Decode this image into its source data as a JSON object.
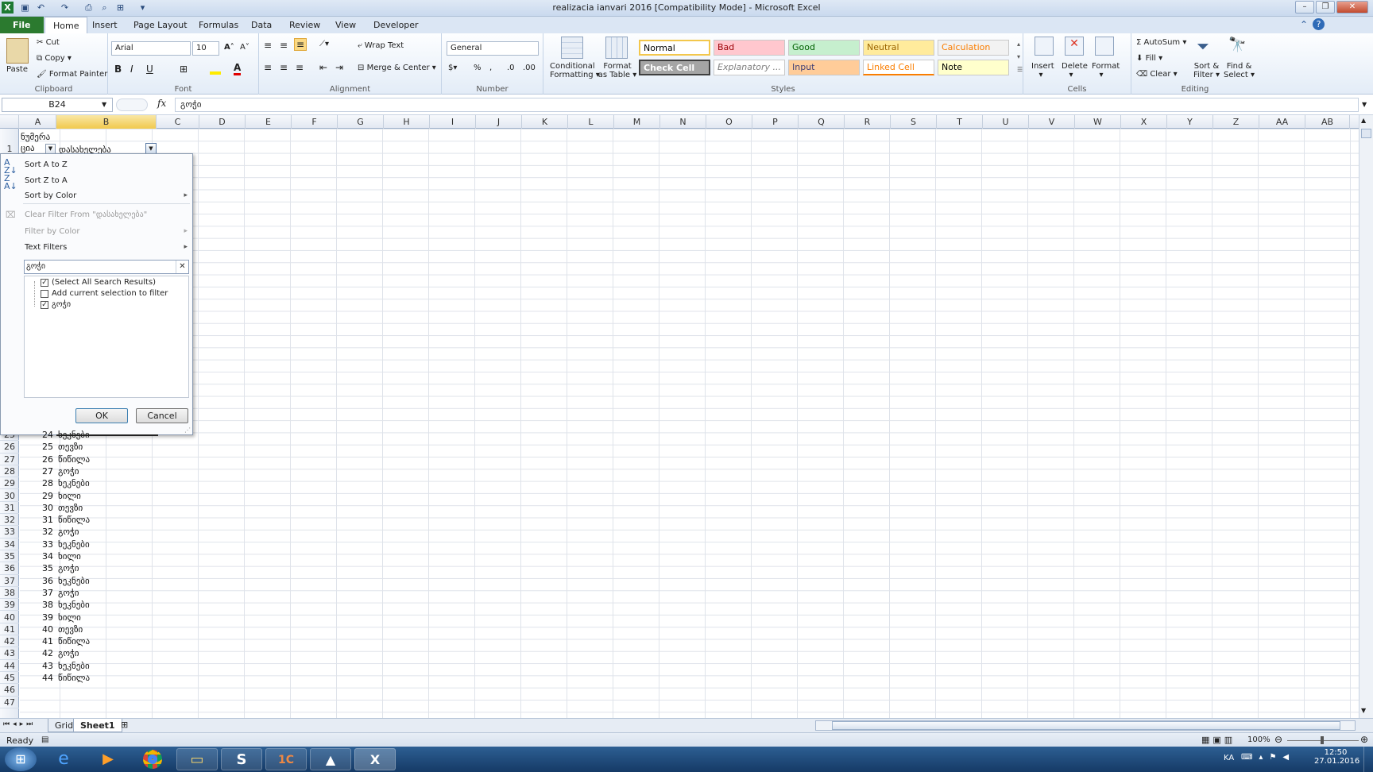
{
  "window": {
    "title": "realizacia ianvari 2016  [Compatibility Mode]  -  Microsoft Excel"
  },
  "tabs": [
    "File",
    "Home",
    "Insert",
    "Page Layout",
    "Formulas",
    "Data",
    "Review",
    "View",
    "Developer"
  ],
  "ribbon": {
    "clipboard": {
      "paste": "Paste",
      "cut": "Cut",
      "copy": "Copy",
      "format_painter": "Format Painter",
      "label": "Clipboard"
    },
    "font": {
      "name": "Arial",
      "size": "10",
      "label": "Font"
    },
    "alignment": {
      "wrap": "Wrap Text",
      "merge": "Merge & Center",
      "label": "Alignment"
    },
    "number": {
      "format": "General",
      "label": "Number"
    },
    "styles": {
      "conditional": "Conditional",
      "conditional2": "Formatting",
      "format_table": "Format",
      "format_table2": "as Table",
      "label": "Styles",
      "items": [
        {
          "name": "Normal",
          "bg": "#ffffff",
          "fg": "#000000"
        },
        {
          "name": "Bad",
          "bg": "#ffc7ce",
          "fg": "#9c0006"
        },
        {
          "name": "Good",
          "bg": "#c6efce",
          "fg": "#006100"
        },
        {
          "name": "Neutral",
          "bg": "#ffeb9c",
          "fg": "#9c6500"
        },
        {
          "name": "Calculation",
          "bg": "#f2f2f2",
          "fg": "#fa7d00"
        },
        {
          "name": "Check Cell",
          "bg": "#a5a5a5",
          "fg": "#ffffff"
        },
        {
          "name": "Explanatory ...",
          "bg": "#ffffff",
          "fg": "#7f7f7f"
        },
        {
          "name": "Input",
          "bg": "#ffcc99",
          "fg": "#3f3f76"
        },
        {
          "name": "Linked Cell",
          "bg": "#ffffff",
          "fg": "#fa7d00"
        },
        {
          "name": "Note",
          "bg": "#ffffcc",
          "fg": "#000000"
        }
      ]
    },
    "cells": {
      "insert": "Insert",
      "delete": "Delete",
      "format": "Format",
      "label": "Cells"
    },
    "editing": {
      "autosum": "AutoSum",
      "fill": "Fill",
      "clear": "Clear",
      "sort": "Sort &",
      "sort2": "Filter",
      "find": "Find &",
      "find2": "Select",
      "label": "Editing"
    }
  },
  "formula_bar": {
    "name_box": "B24",
    "fx": "fx",
    "value": "გოჭი"
  },
  "columns": [
    "A",
    "B",
    "C",
    "D",
    "E",
    "F",
    "G",
    "H",
    "I",
    "J",
    "K",
    "L",
    "M",
    "N",
    "O",
    "P",
    "Q",
    "R",
    "S",
    "T",
    "U",
    "V",
    "W",
    "X",
    "Y",
    "Z",
    "AA",
    "AB"
  ],
  "header_row": {
    "a_line1": "ნუმერა",
    "a_line2": "ცია",
    "b": "დასახელება"
  },
  "rows": [
    {
      "r": "25",
      "a": "24",
      "b": "ხეკნები"
    },
    {
      "r": "26",
      "a": "25",
      "b": "თევზი"
    },
    {
      "r": "27",
      "a": "26",
      "b": "წიწილა"
    },
    {
      "r": "28",
      "a": "27",
      "b": "გოჭი"
    },
    {
      "r": "29",
      "a": "28",
      "b": "ხეკნები"
    },
    {
      "r": "30",
      "a": "29",
      "b": "ხილი"
    },
    {
      "r": "31",
      "a": "30",
      "b": "თევზი"
    },
    {
      "r": "32",
      "a": "31",
      "b": "წიწილა"
    },
    {
      "r": "33",
      "a": "32",
      "b": "გოჭი"
    },
    {
      "r": "34",
      "a": "33",
      "b": "ხეკნები"
    },
    {
      "r": "35",
      "a": "34",
      "b": "ხილი"
    },
    {
      "r": "36",
      "a": "35",
      "b": "გოჭი"
    },
    {
      "r": "37",
      "a": "36",
      "b": "ხეკნები"
    },
    {
      "r": "38",
      "a": "37",
      "b": "გოჭი"
    },
    {
      "r": "39",
      "a": "38",
      "b": "ხეკნები"
    },
    {
      "r": "40",
      "a": "39",
      "b": "ხილი"
    },
    {
      "r": "41",
      "a": "40",
      "b": "თევზი"
    },
    {
      "r": "42",
      "a": "41",
      "b": "წიწილა"
    },
    {
      "r": "43",
      "a": "42",
      "b": "გოჭი"
    },
    {
      "r": "44",
      "a": "43",
      "b": "ხეკნები"
    },
    {
      "r": "45",
      "a": "44",
      "b": "წიწილა"
    },
    {
      "r": "46",
      "a": "",
      "b": ""
    },
    {
      "r": "47",
      "a": "",
      "b": ""
    }
  ],
  "filter_menu": {
    "sort_az": "Sort A to Z",
    "sort_za": "Sort Z to A",
    "sort_color": "Sort by Color",
    "clear_filter": "Clear Filter From \"დასახელება\"",
    "filter_color": "Filter by Color",
    "text_filters": "Text Filters",
    "search_value": "გოჭი",
    "list": [
      {
        "label": "(Select All Search Results)",
        "checked": true
      },
      {
        "label": "Add current selection to filter",
        "checked": false
      },
      {
        "label": "გოჭი",
        "checked": true
      }
    ],
    "ok": "OK",
    "cancel": "Cancel"
  },
  "sheets": {
    "tabs": [
      "Grid",
      "Sheet1"
    ],
    "active": "Sheet1"
  },
  "status": {
    "ready": "Ready",
    "zoom": "100%"
  },
  "taskbar": {
    "lang": "KA",
    "time": "12:50",
    "date": "27.01.2016"
  }
}
